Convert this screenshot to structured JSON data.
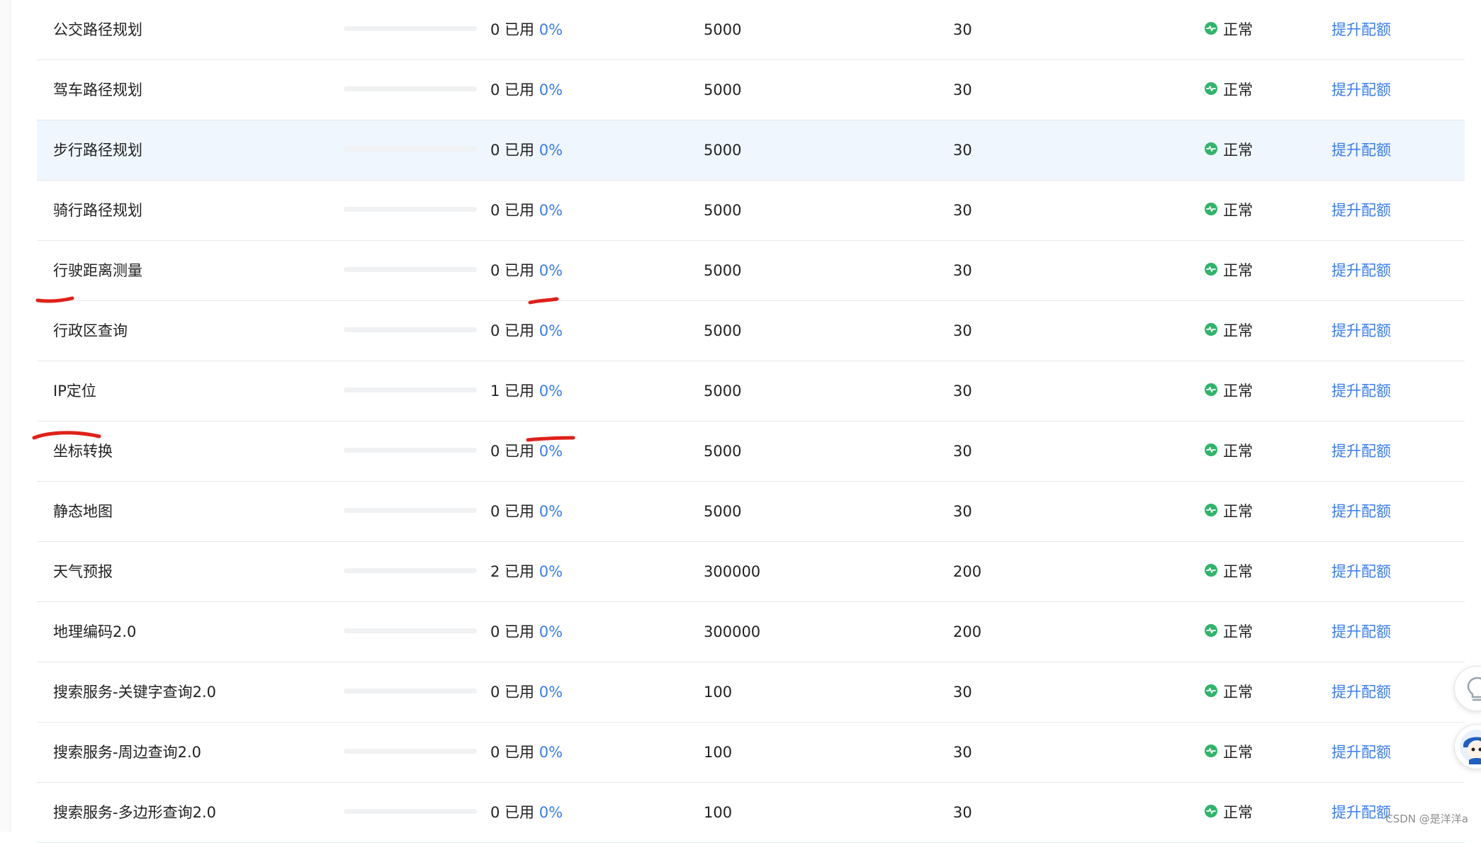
{
  "rows": [
    {
      "name": "公交路径规划",
      "used": "0 已用",
      "percent": "0%",
      "progress": 0,
      "quota": "5000",
      "qps": "30",
      "status": "正常",
      "action": "提升配额"
    },
    {
      "name": "驾车路径规划",
      "used": "0 已用",
      "percent": "0%",
      "progress": 0,
      "quota": "5000",
      "qps": "30",
      "status": "正常",
      "action": "提升配额"
    },
    {
      "name": "步行路径规划",
      "used": "0 已用",
      "percent": "0%",
      "progress": 0,
      "quota": "5000",
      "qps": "30",
      "status": "正常",
      "action": "提升配额"
    },
    {
      "name": "骑行路径规划",
      "used": "0 已用",
      "percent": "0%",
      "progress": 0,
      "quota": "5000",
      "qps": "30",
      "status": "正常",
      "action": "提升配额"
    },
    {
      "name": "行驶距离测量",
      "used": "0 已用",
      "percent": "0%",
      "progress": 0,
      "quota": "5000",
      "qps": "30",
      "status": "正常",
      "action": "提升配额"
    },
    {
      "name": "行政区查询",
      "used": "0 已用",
      "percent": "0%",
      "progress": 0,
      "quota": "5000",
      "qps": "30",
      "status": "正常",
      "action": "提升配额"
    },
    {
      "name": "IP定位",
      "used": "1 已用",
      "percent": "0%",
      "progress": 0,
      "quota": "5000",
      "qps": "30",
      "status": "正常",
      "action": "提升配额"
    },
    {
      "name": "坐标转换",
      "used": "0 已用",
      "percent": "0%",
      "progress": 0,
      "quota": "5000",
      "qps": "30",
      "status": "正常",
      "action": "提升配额"
    },
    {
      "name": "静态地图",
      "used": "0 已用",
      "percent": "0%",
      "progress": 0,
      "quota": "5000",
      "qps": "30",
      "status": "正常",
      "action": "提升配额"
    },
    {
      "name": "天气预报",
      "used": "2 已用",
      "percent": "0%",
      "progress": 0,
      "quota": "300000",
      "qps": "200",
      "status": "正常",
      "action": "提升配额"
    },
    {
      "name": "地理编码2.0",
      "used": "0 已用",
      "percent": "0%",
      "progress": 0,
      "quota": "300000",
      "qps": "200",
      "status": "正常",
      "action": "提升配额"
    },
    {
      "name": "搜索服务-关键字查询2.0",
      "used": "0 已用",
      "percent": "0%",
      "progress": 0,
      "quota": "100",
      "qps": "30",
      "status": "正常",
      "action": "提升配额"
    },
    {
      "name": "搜索服务-周边查询2.0",
      "used": "0 已用",
      "percent": "0%",
      "progress": 0,
      "quota": "100",
      "qps": "30",
      "status": "正常",
      "action": "提升配额"
    },
    {
      "name": "搜索服务-多边形查询2.0",
      "used": "0 已用",
      "percent": "0%",
      "progress": 0,
      "quota": "100",
      "qps": "30",
      "status": "正常",
      "action": "提升配额"
    }
  ],
  "highlighted_row": 2,
  "colors": {
    "accent": "#3a7cf0",
    "status_ok": "#2fb56a",
    "row_highlight": "#eff6fd",
    "annotation": "#e0201a"
  },
  "icons": {
    "status": "status-ok-icon",
    "hint": "lightbulb-icon",
    "assistant": "assistant-avatar-icon"
  },
  "watermark": "CSDN @是洋洋a"
}
